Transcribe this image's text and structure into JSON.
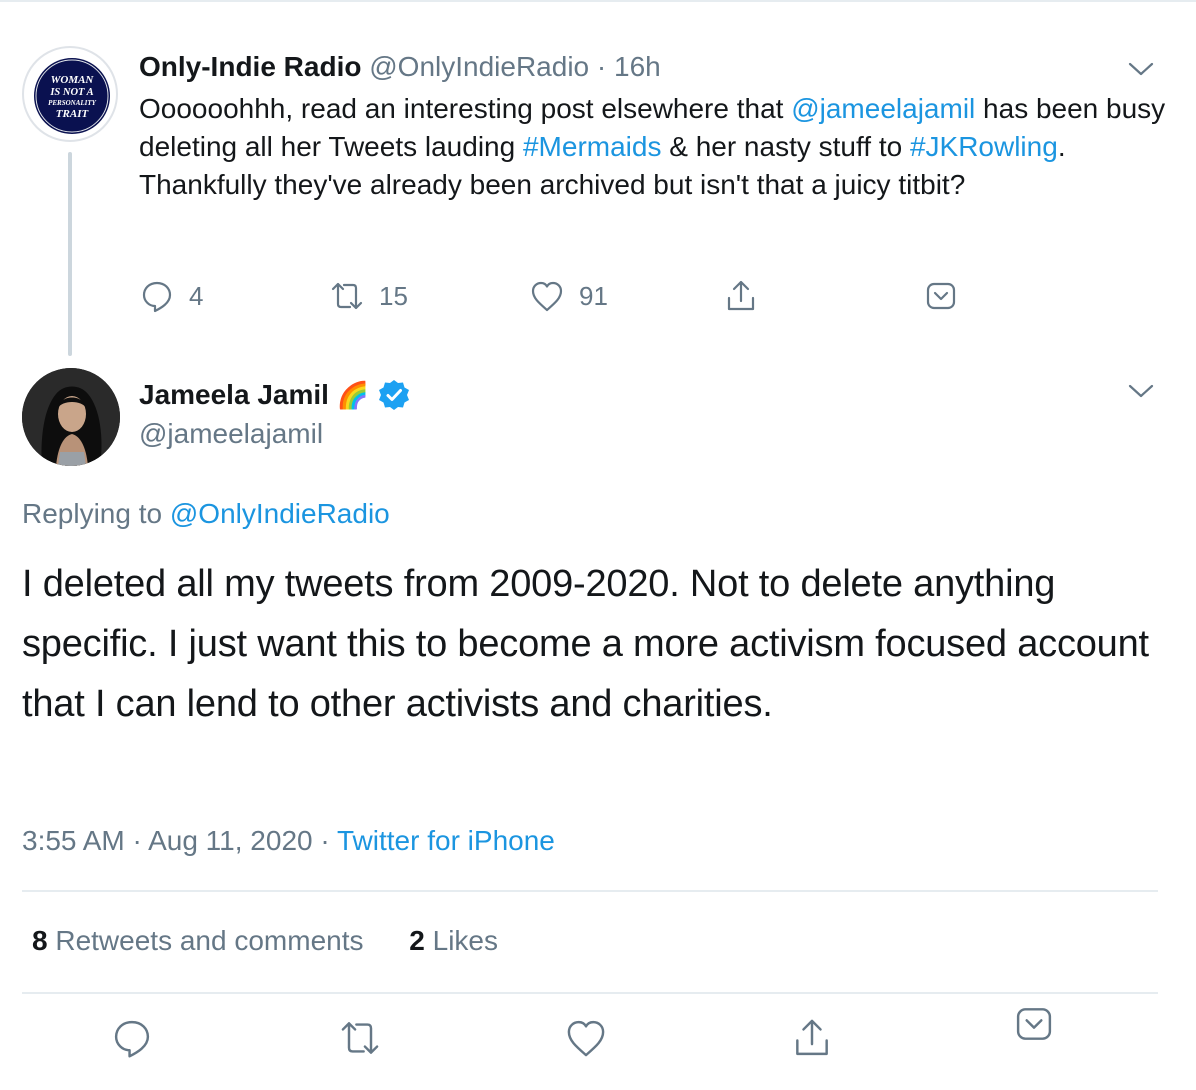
{
  "parent_tweet": {
    "avatar_lines": [
      "WOMAN",
      "IS NOT A",
      "PERSONALITY",
      "TRAIT"
    ],
    "name": "Only-Indie Radio",
    "handle": "@OnlyIndieRadio",
    "separator": "·",
    "time": "16h",
    "text_parts": [
      {
        "t": "Oooooohhh, read an interesting post elsewhere that ",
        "link": false
      },
      {
        "t": "@jameelajamil",
        "link": true
      },
      {
        "t": " has been busy deleting all her Tweets lauding ",
        "link": false
      },
      {
        "t": "#Mermaids",
        "link": true
      },
      {
        "t": " & her nasty stuff to ",
        "link": false
      },
      {
        "t": "#JKRowling",
        "link": true
      },
      {
        "t": ". Thankfully they've already been archived but isn't that a juicy titbit?",
        "link": false
      }
    ],
    "actions": {
      "reply_count": "4",
      "retweet_count": "15",
      "like_count": "91"
    }
  },
  "main_tweet": {
    "name": "Jameela Jamil",
    "name_emoji": "🌈",
    "handle": "@jameelajamil",
    "replying_prefix": "Replying to ",
    "replying_to": "@OnlyIndieRadio",
    "text": "I deleted all my tweets from 2009-2020. Not to delete anything specific. I just want this to become a more activism focused account that I can lend to other activists and charities.",
    "time": "3:55 AM",
    "date": "Aug 11, 2020",
    "source": "Twitter for iPhone",
    "separator": "·",
    "retweets_count": "8",
    "retweets_label": "Retweets and comments",
    "likes_count": "2",
    "likes_label": "Likes"
  },
  "icons": [
    "chevron-down-icon",
    "reply-icon",
    "retweet-icon",
    "like-icon",
    "share-icon",
    "bookmark-icon",
    "verified-icon"
  ],
  "colors": {
    "link": "#1b95e0",
    "muted": "#657786",
    "text": "#14171a",
    "divider": "#e6ecf0",
    "verified": "#1da1f2"
  }
}
